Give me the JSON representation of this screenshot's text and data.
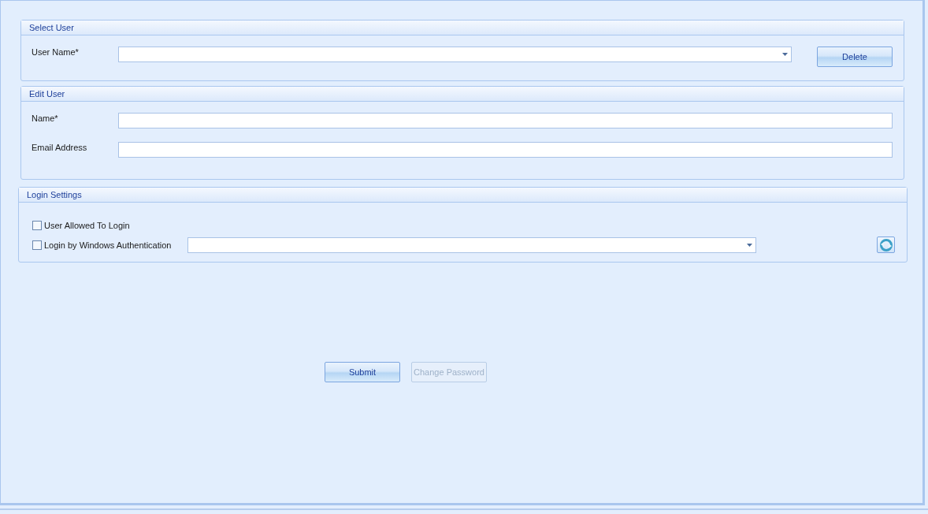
{
  "select_user": {
    "title": "Select User",
    "user_name": {
      "label": "User Name*"
    },
    "delete_button": {
      "label": "Delete",
      "disabled": false
    }
  },
  "edit_user": {
    "title": "Edit User",
    "fields": [
      {
        "label": "Name*"
      },
      {
        "label": "Email Address"
      }
    ]
  },
  "login_settings": {
    "title": "Login Settings",
    "options": [
      {
        "label": "User Allowed To Login",
        "checked": false,
        "kind": "plain"
      },
      {
        "label": "Login by Windows Authentication",
        "checked": false,
        "kind": "dropdown"
      }
    ]
  },
  "buttons": [
    {
      "label": "Submit",
      "disabled": false
    },
    {
      "label": "Change Password",
      "disabled": true
    }
  ]
}
